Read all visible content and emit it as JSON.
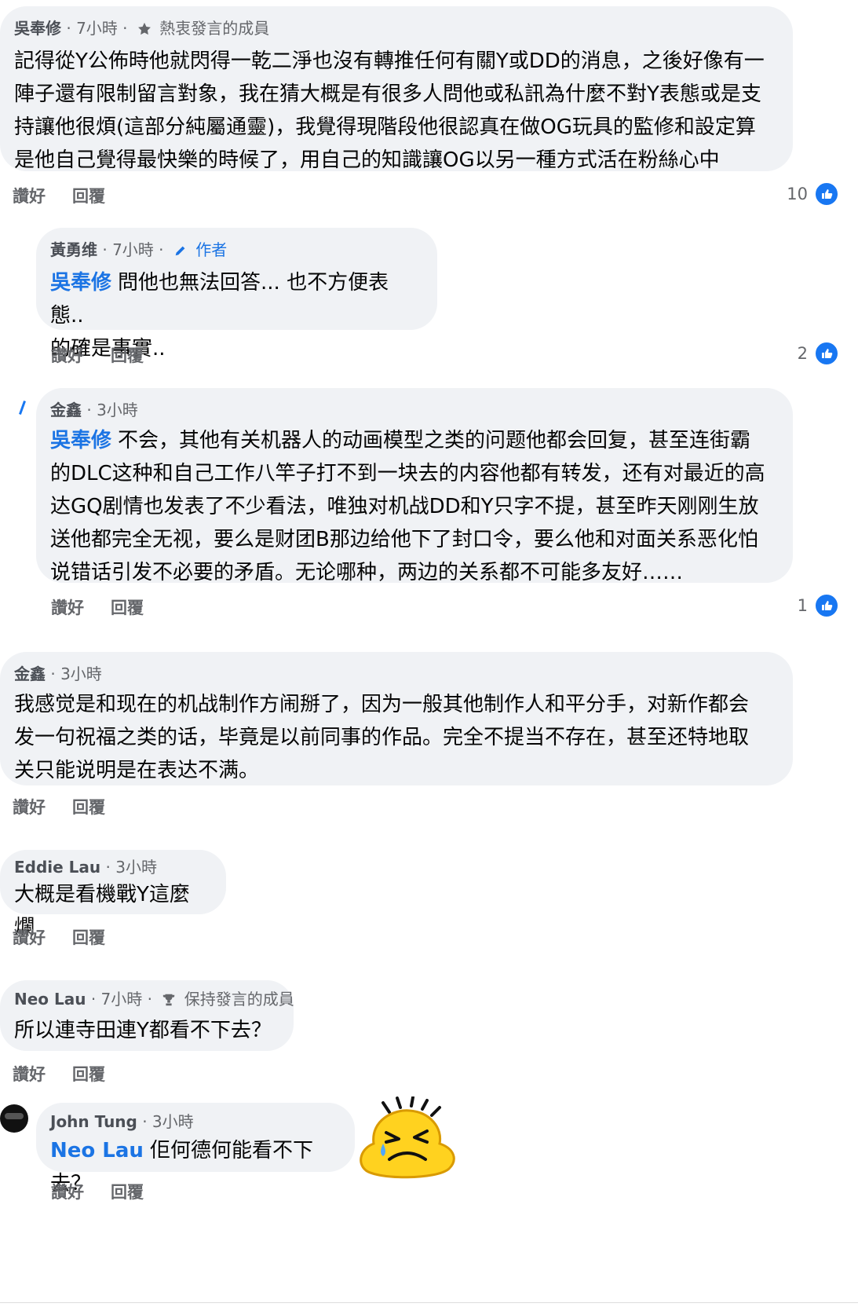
{
  "comments": [
    {
      "author": "吳奉修",
      "time": "· 7小時 ·",
      "badge": "熱衷發言的成員",
      "lines": [
        "記得從Y公佈時他就閃得一乾二淨也沒有轉推任何有關Y或DD的消息，之後好像有一",
        "陣子還有限制留言對象，我在猜大概是有很多人問他或私訊為什麼不對Y表態或是支",
        "持讓他很煩(這部分純屬通靈)，我覺得現階段他很認真在做OG玩具的監修和設定算",
        "是他自己覺得最快樂的時候了，用自己的知識讓OG以另一種方式活在粉絲心中"
      ],
      "like_label": "讚好",
      "reply_label": "回覆",
      "reaction_count": "10"
    },
    {
      "author": "黃勇维",
      "time": "· 7小時 ·",
      "badge": "作者",
      "mention": "吳奉修",
      "lines": [
        "問他也無法回答... 也不方便表態..",
        "的確是事實.."
      ],
      "like_label": "讚好",
      "reply_label": "回覆",
      "reaction_count": "2"
    },
    {
      "author": "金鑫",
      "time": "· 3小時",
      "mention": "吳奉修",
      "lines": [
        "不会，其他有关机器人的动画模型之类的问题他都会回复，甚至连街霸",
        "的DLC这种和自己工作八竿子打不到一块去的内容他都有转发，还有对最近的高",
        "达GQ剧情也发表了不少看法，唯独对机战DD和Y只字不提，甚至昨天刚刚生放",
        "送他都完全无视，要么是财团B那边给他下了封口令，要么他和对面关系恶化怕",
        "说错话引发不必要的矛盾。无论哪种，两边的关系都不可能多友好……"
      ],
      "like_label": "讚好",
      "reply_label": "回覆",
      "reaction_count": "1"
    },
    {
      "author": "金鑫",
      "time": "· 3小時",
      "lines": [
        "我感觉是和现在的机战制作方闹掰了，因为一般其他制作人和平分手，对新作都会",
        "发一句祝福之类的话，毕竟是以前同事的作品。完全不提当不存在，甚至还特地取",
        "关只能说明是在表达不满。"
      ],
      "like_label": "讚好",
      "reply_label": "回覆"
    },
    {
      "author": "Eddie Lau",
      "time": "· 3小時",
      "lines": [
        "大概是看機戰Y這麼爛"
      ],
      "like_label": "讚好",
      "reply_label": "回覆"
    },
    {
      "author": "Neo Lau",
      "time": "· 7小時 ·",
      "badge": "保持發言的成員",
      "lines": [
        "所以連寺田連Y都看不下去？"
      ],
      "like_label": "讚好",
      "reply_label": "回覆"
    },
    {
      "author": "John Tung",
      "time": "· 3小時",
      "mention": "Neo Lau",
      "lines": [
        "佢何德何能看不下去？"
      ],
      "like_label": "讚好",
      "reply_label": "回覆"
    }
  ],
  "colors": {
    "bubble": "#f0f2f5",
    "mention": "#1b74e4",
    "like": "#1877f2",
    "meta": "#65676b"
  },
  "icons": {
    "top_fan_badge": "star-icon",
    "author_badge": "pencil-icon",
    "rising_badge": "trophy-icon",
    "reaction": "thumbs-up-icon",
    "sticker": "crying-face-sticker"
  }
}
